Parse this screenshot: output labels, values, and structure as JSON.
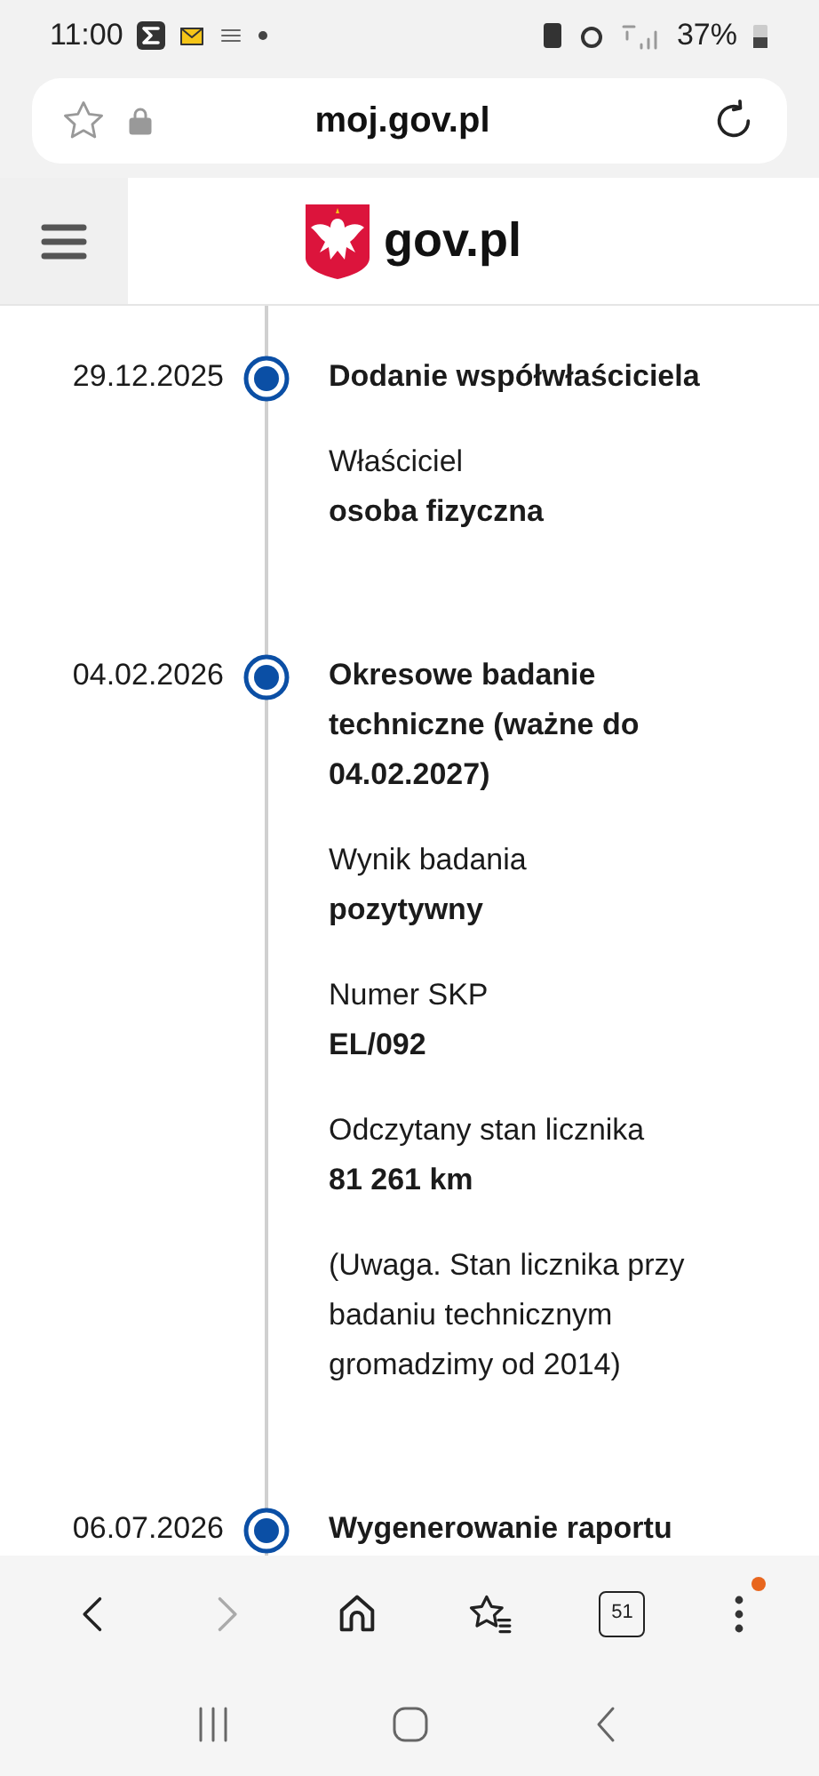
{
  "status_bar": {
    "time": "11:00",
    "battery": "37%"
  },
  "browser": {
    "url": "moj.gov.pl"
  },
  "header": {
    "logo_text": "gov.pl"
  },
  "timeline": [
    {
      "date": "29.12.2025",
      "title": "Dodanie współwłaściciela",
      "fields": [
        {
          "label": "Właściciel",
          "value": "osoba fizyczna"
        }
      ]
    },
    {
      "date": "04.02.2026",
      "title": "Okresowe badanie techniczne (ważne do 04.02.2027)",
      "fields": [
        {
          "label": "Wynik badania",
          "value": "pozytywny"
        },
        {
          "label": "Numer SKP",
          "value": "EL/092"
        },
        {
          "label": "Odczytany stan licznika",
          "value": "81 261 km"
        }
      ],
      "note": "(Uwaga. Stan licznika przy badaniu technicznym gromadzimy od 2014)"
    },
    {
      "date": "06.07.2026",
      "title": "Wygenerowanie raportu"
    }
  ],
  "bottom_nav": {
    "tab_count": "51",
    "menu_notification": true
  }
}
